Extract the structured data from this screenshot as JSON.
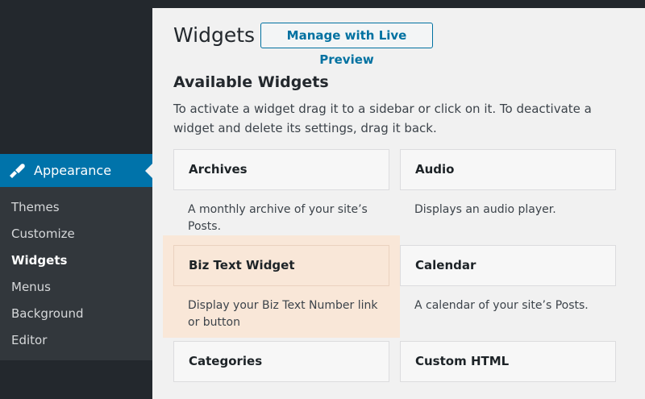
{
  "sidebar": {
    "active_menu": {
      "label": "Appearance",
      "icon": "paintbrush-icon"
    },
    "submenu": [
      {
        "label": "Themes",
        "current": false
      },
      {
        "label": "Customize",
        "current": false
      },
      {
        "label": "Widgets",
        "current": true
      },
      {
        "label": "Menus",
        "current": false
      },
      {
        "label": "Background",
        "current": false
      },
      {
        "label": "Editor",
        "current": false
      }
    ]
  },
  "header": {
    "title": "Widgets",
    "live_preview_button": "Manage with Live Preview"
  },
  "available": {
    "title": "Available Widgets",
    "description": "To activate a widget drag it to a sidebar or click on it. To deactivate a widget and delete its settings, drag it back."
  },
  "widgets": [
    {
      "name": "Archives",
      "description": "A monthly archive of your site’s Posts."
    },
    {
      "name": "Audio",
      "description": "Displays an audio player."
    },
    {
      "name": "Biz Text Widget",
      "description": "Display your Biz Text Number link or button"
    },
    {
      "name": "Calendar",
      "description": "A calendar of your site’s Posts."
    },
    {
      "name": "Categories",
      "description": ""
    },
    {
      "name": "Custom HTML",
      "description": ""
    }
  ],
  "colors": {
    "accent": "#0073aa",
    "sidebar_bg": "#23282d",
    "highlight": "#f9e7d8"
  }
}
